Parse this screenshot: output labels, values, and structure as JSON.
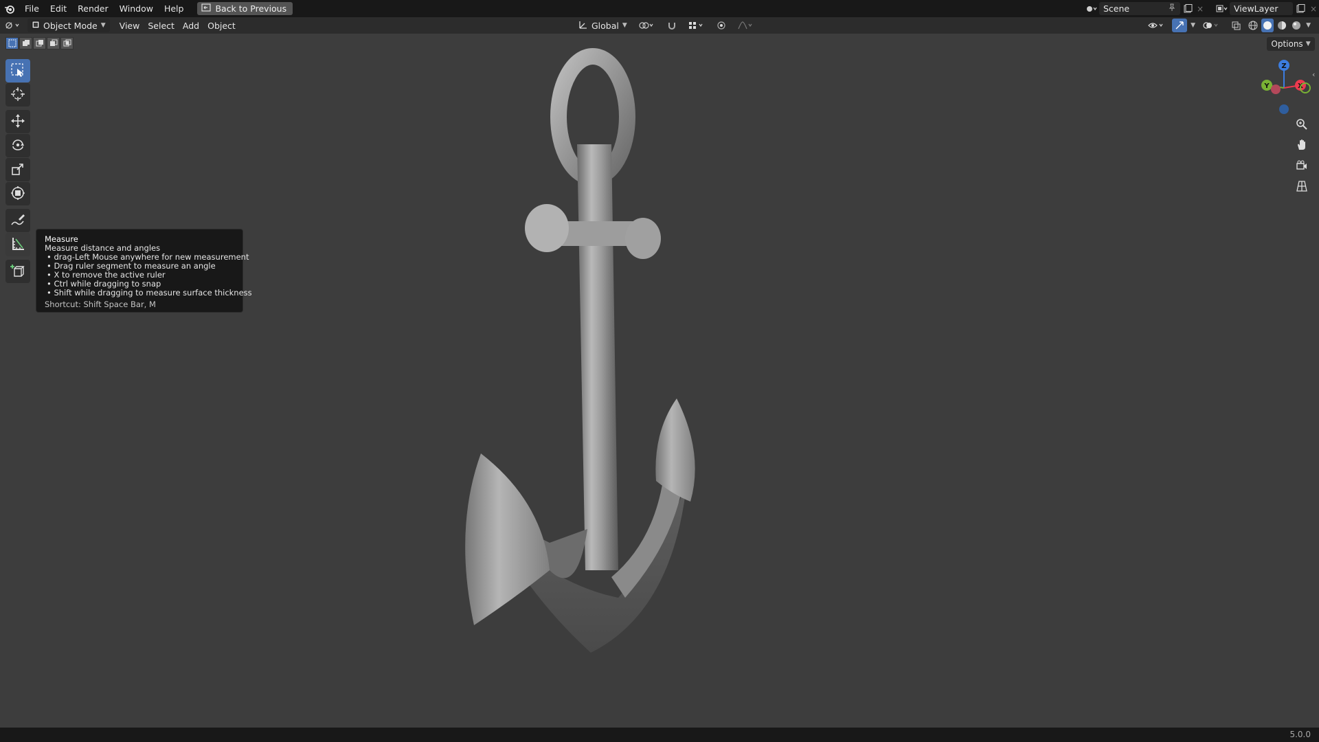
{
  "menubar": {
    "items": [
      "File",
      "Edit",
      "Render",
      "Window",
      "Help"
    ],
    "back_button": "Back to Previous"
  },
  "topbar_right": {
    "scene": "Scene",
    "view_layer": "ViewLayer"
  },
  "header": {
    "mode": "Object Mode",
    "menus": [
      "View",
      "Select",
      "Add",
      "Object"
    ],
    "orientation": "Global",
    "options": "Options"
  },
  "tools": [
    {
      "name": "select-box",
      "icon": "select-box-icon"
    },
    {
      "name": "cursor",
      "icon": "cursor-icon"
    },
    {
      "name": "move",
      "icon": "move-icon"
    },
    {
      "name": "rotate",
      "icon": "rotate-icon"
    },
    {
      "name": "scale",
      "icon": "scale-icon"
    },
    {
      "name": "transform",
      "icon": "transform-icon"
    },
    {
      "name": "annotate",
      "icon": "annotate-icon"
    },
    {
      "name": "measure",
      "icon": "measure-icon"
    },
    {
      "name": "add-cube",
      "icon": "add-cube-icon"
    }
  ],
  "tooltip": {
    "title": "Measure",
    "description": "Measure distance and angles",
    "bullets": [
      "• drag-Left Mouse anywhere for new measurement",
      "• Drag ruler segment to measure an angle",
      "• X to remove the active ruler",
      "• Ctrl while dragging to snap",
      "• Shift while dragging to measure surface thickness"
    ],
    "shortcut": "Shortcut: Shift Space Bar, M"
  },
  "gizmo": {
    "z": "Z",
    "y": "Y",
    "x": "X",
    "colors": {
      "x": "#ed3a4f",
      "y": "#79b234",
      "z": "#3c7de0"
    }
  },
  "status": {
    "version": "5.0.0"
  },
  "colors": {
    "accent": "#4772b3",
    "viewport_bg": "#3d3d3d",
    "menubar_bg": "#181818",
    "header_bg": "#2c2c2c"
  }
}
